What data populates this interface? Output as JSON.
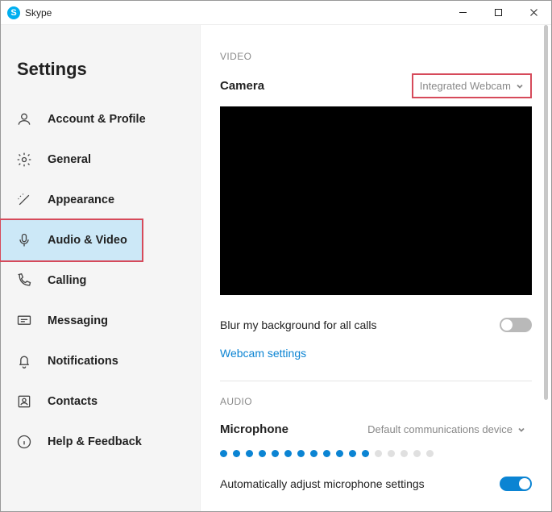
{
  "window": {
    "title": "Skype"
  },
  "sidebar": {
    "title": "Settings",
    "items": [
      {
        "label": "Account & Profile"
      },
      {
        "label": "General"
      },
      {
        "label": "Appearance"
      },
      {
        "label": "Audio & Video"
      },
      {
        "label": "Calling"
      },
      {
        "label": "Messaging"
      },
      {
        "label": "Notifications"
      },
      {
        "label": "Contacts"
      },
      {
        "label": "Help & Feedback"
      }
    ]
  },
  "video": {
    "section": "VIDEO",
    "camera_label": "Camera",
    "camera_value": "Integrated Webcam",
    "blur_label": "Blur my background for all calls",
    "blur_on": false,
    "webcam_link": "Webcam settings"
  },
  "audio": {
    "section": "AUDIO",
    "mic_label": "Microphone",
    "mic_value": "Default communications device",
    "mic_level_filled": 12,
    "mic_level_total": 17,
    "auto_adjust_label": "Automatically adjust microphone settings",
    "auto_adjust_on": true
  },
  "colors": {
    "accent": "#0b84d3",
    "highlight": "#d64a5a",
    "selected_bg": "#cce8f7"
  }
}
